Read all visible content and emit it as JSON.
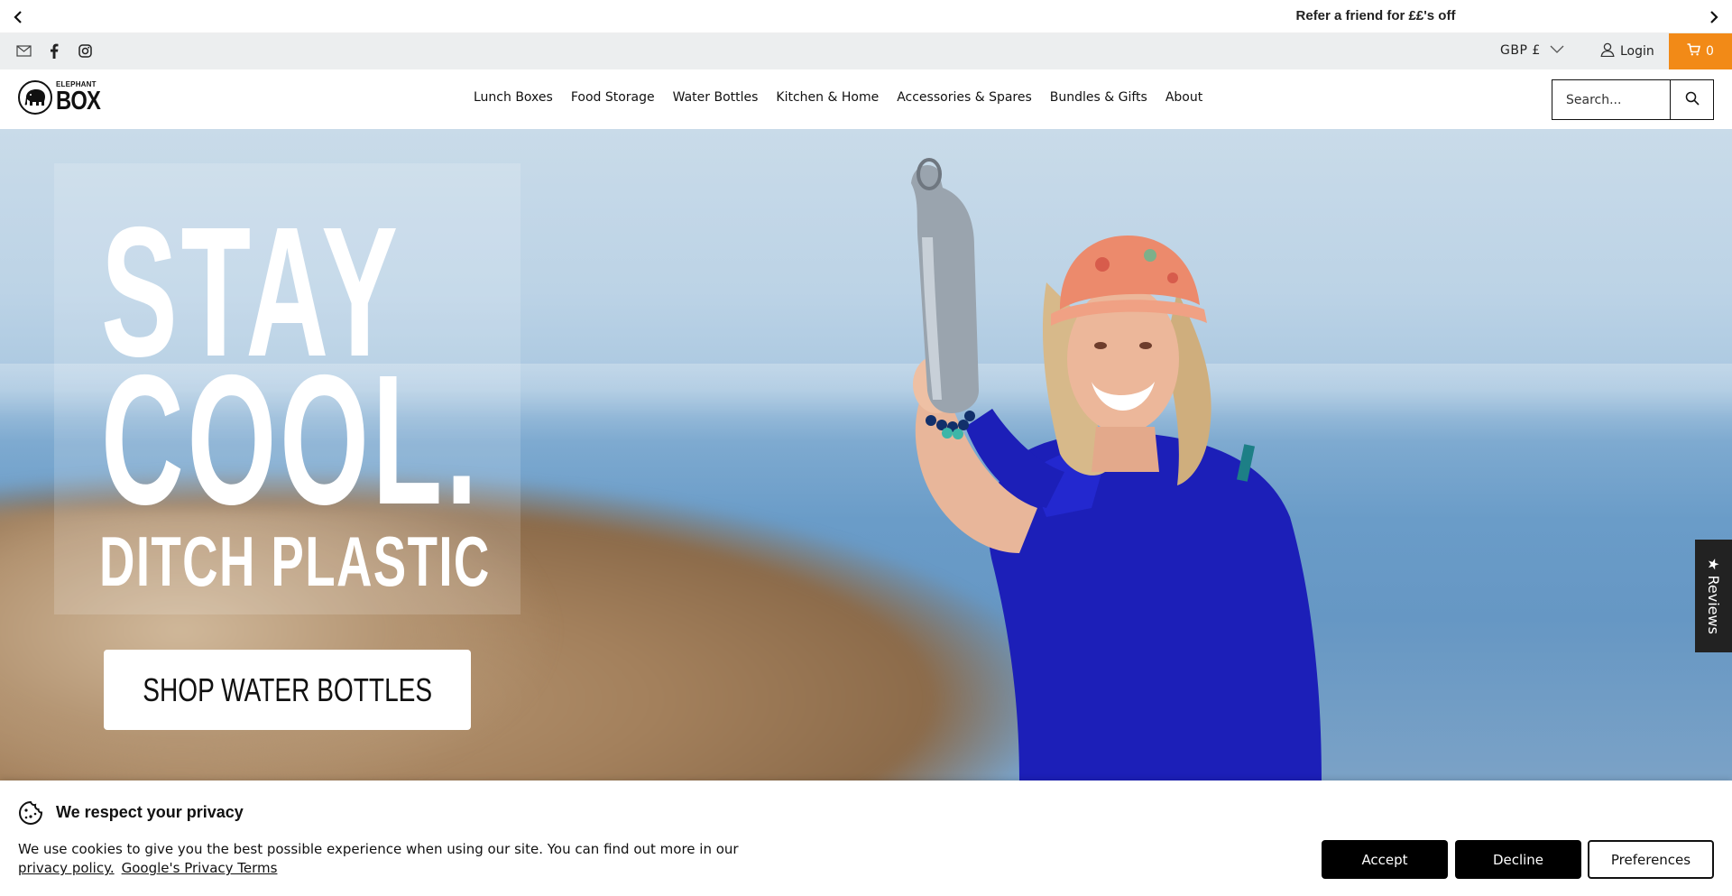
{
  "announcement": {
    "message": "Refer a friend for ££'s off",
    "prev_icon": "chevron-left-icon",
    "next_icon": "chevron-right-icon"
  },
  "utility": {
    "social_icons": [
      "mail-icon",
      "facebook-icon",
      "instagram-icon"
    ],
    "currency": "GBP £",
    "login": "Login",
    "cart_count": "0",
    "cart_color": "#f28a17"
  },
  "header": {
    "logo_small": "ELEPHANT",
    "logo_big": "BOX",
    "nav": [
      "Lunch Boxes",
      "Food Storage",
      "Water Bottles",
      "Kitchen & Home",
      "Accessories & Spares",
      "Bundles & Gifts",
      "About"
    ],
    "search_placeholder": "Search..."
  },
  "hero": {
    "line1": "STAY",
    "line2": "COOL.",
    "line3": "DITCH PLASTIC",
    "cta": "SHOP WATER BOTTLES"
  },
  "reviews_tab": "★ Reviews",
  "cookie": {
    "title": "We respect your privacy",
    "text": "We use cookies to give you the best possible experience when using our site. You can find out more in our",
    "privacy_link": "privacy policy.",
    "google_link": "Google's Privacy Terms",
    "accept": "Accept",
    "decline": "Decline",
    "preferences": "Preferences"
  }
}
